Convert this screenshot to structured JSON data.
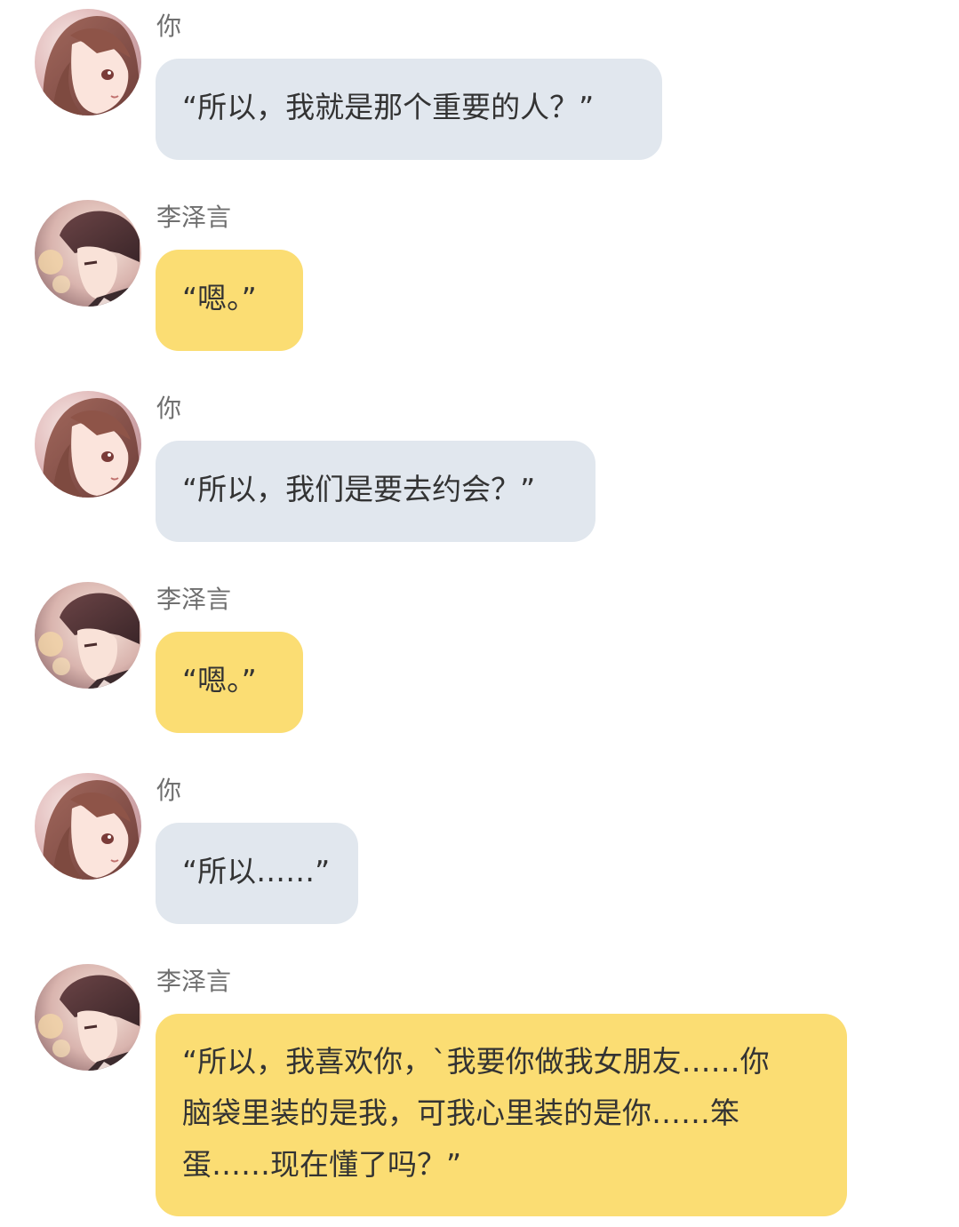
{
  "messages": [
    {
      "sender": "你",
      "role": "you",
      "text": "“所以，我就是那个重要的人？”"
    },
    {
      "sender": "李泽言",
      "role": "him",
      "text": "“嗯。”"
    },
    {
      "sender": "你",
      "role": "you",
      "text": "“所以，我们是要去约会？”"
    },
    {
      "sender": "李泽言",
      "role": "him",
      "text": "“嗯。”"
    },
    {
      "sender": "你",
      "role": "you",
      "text": "“所以……”"
    },
    {
      "sender": "李泽言",
      "role": "him",
      "lines": [
        "“所以，我喜欢你，`我要你做我女朋友……你",
        "脑袋里装的是我，可我心里装的是你……笨",
        "蛋……现在懂了吗？”"
      ]
    }
  ],
  "colors": {
    "you_bubble": "#e1e7ee",
    "him_bubble": "#fbdd73",
    "sender_name": "#6f6f6f",
    "message_text": "#333333"
  },
  "avatars": {
    "you": "girl-avatar-icon",
    "him": "boy-avatar-icon"
  }
}
